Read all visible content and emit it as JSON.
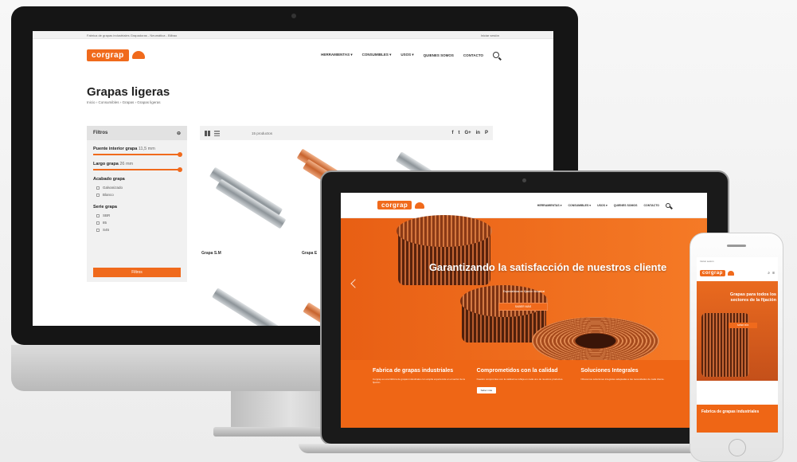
{
  "desktop": {
    "topbar_left": "Fabrica de grapas industriales Grapadoras - Neumática - Bilbao",
    "topbar_right": "Iniciar sesión",
    "logo": "corgrap",
    "menu": [
      "HERRAMIENTAS ▾",
      "CONSUMIBLES ▾",
      "USOS ▾",
      "QUIENES SOMOS",
      "CONTACTO"
    ],
    "page_title": "Grapas ligeras",
    "breadcrumb": "Inicio › Consumibles › Grapas › Grapas ligeras",
    "filters": {
      "title": "Filtros",
      "group1_label": "Puente interior grapa",
      "group1_value": "11,5 mm",
      "group2_label": "Largo grapa",
      "group2_value": "26 mm",
      "group3_label": "Acabado grapa",
      "group3_options": [
        "Galvanizado",
        "Blanco"
      ],
      "group4_label": "Serie grapa",
      "group4_options": [
        "SBR",
        "85",
        "S45"
      ],
      "apply_button": "Filtros"
    },
    "toolbar": {
      "count": "15 productos",
      "share": [
        "f",
        "t",
        "G+",
        "in",
        "P"
      ]
    },
    "products": [
      "Grapa S.M",
      "Grapa E"
    ]
  },
  "laptop": {
    "logo": "corgrap",
    "menu": [
      "HERRAMIENTAS ▾",
      "CONSUMIBLES ▾",
      "USOS ▾",
      "QUIENES SOMOS",
      "CONTACTO"
    ],
    "hero_title": "Garantizando la satisfacción de nuestros cliente",
    "hero_subtitle": "Especialistas en fijación industrial",
    "hero_button": "SABER MÁS",
    "columns": [
      {
        "title": "Fabrica de grapas industriales",
        "text": "Corgrap es una fábrica de grapas industriales con amplia experiencia en el sector de la fijación."
      },
      {
        "title": "Comprometidos con la calidad",
        "text": "Nuestro compromiso con la calidad se refleja en cada uno de nuestros productos.",
        "button": "Saber más"
      },
      {
        "title": "Soluciones Integrales",
        "text": "Ofrecemos soluciones integrales adaptadas a las necesidades de cada cliente."
      }
    ]
  },
  "phone": {
    "topbar": "Iniciar sesión",
    "logo": "corgrap",
    "hero_title": "Grapas para todos los sectores de la fijación",
    "hero_button": "SABER MÁS",
    "card_title": "Fabrica de grapas industriales"
  },
  "colors": {
    "brand": "#f06a1c",
    "dark": "#151515"
  }
}
